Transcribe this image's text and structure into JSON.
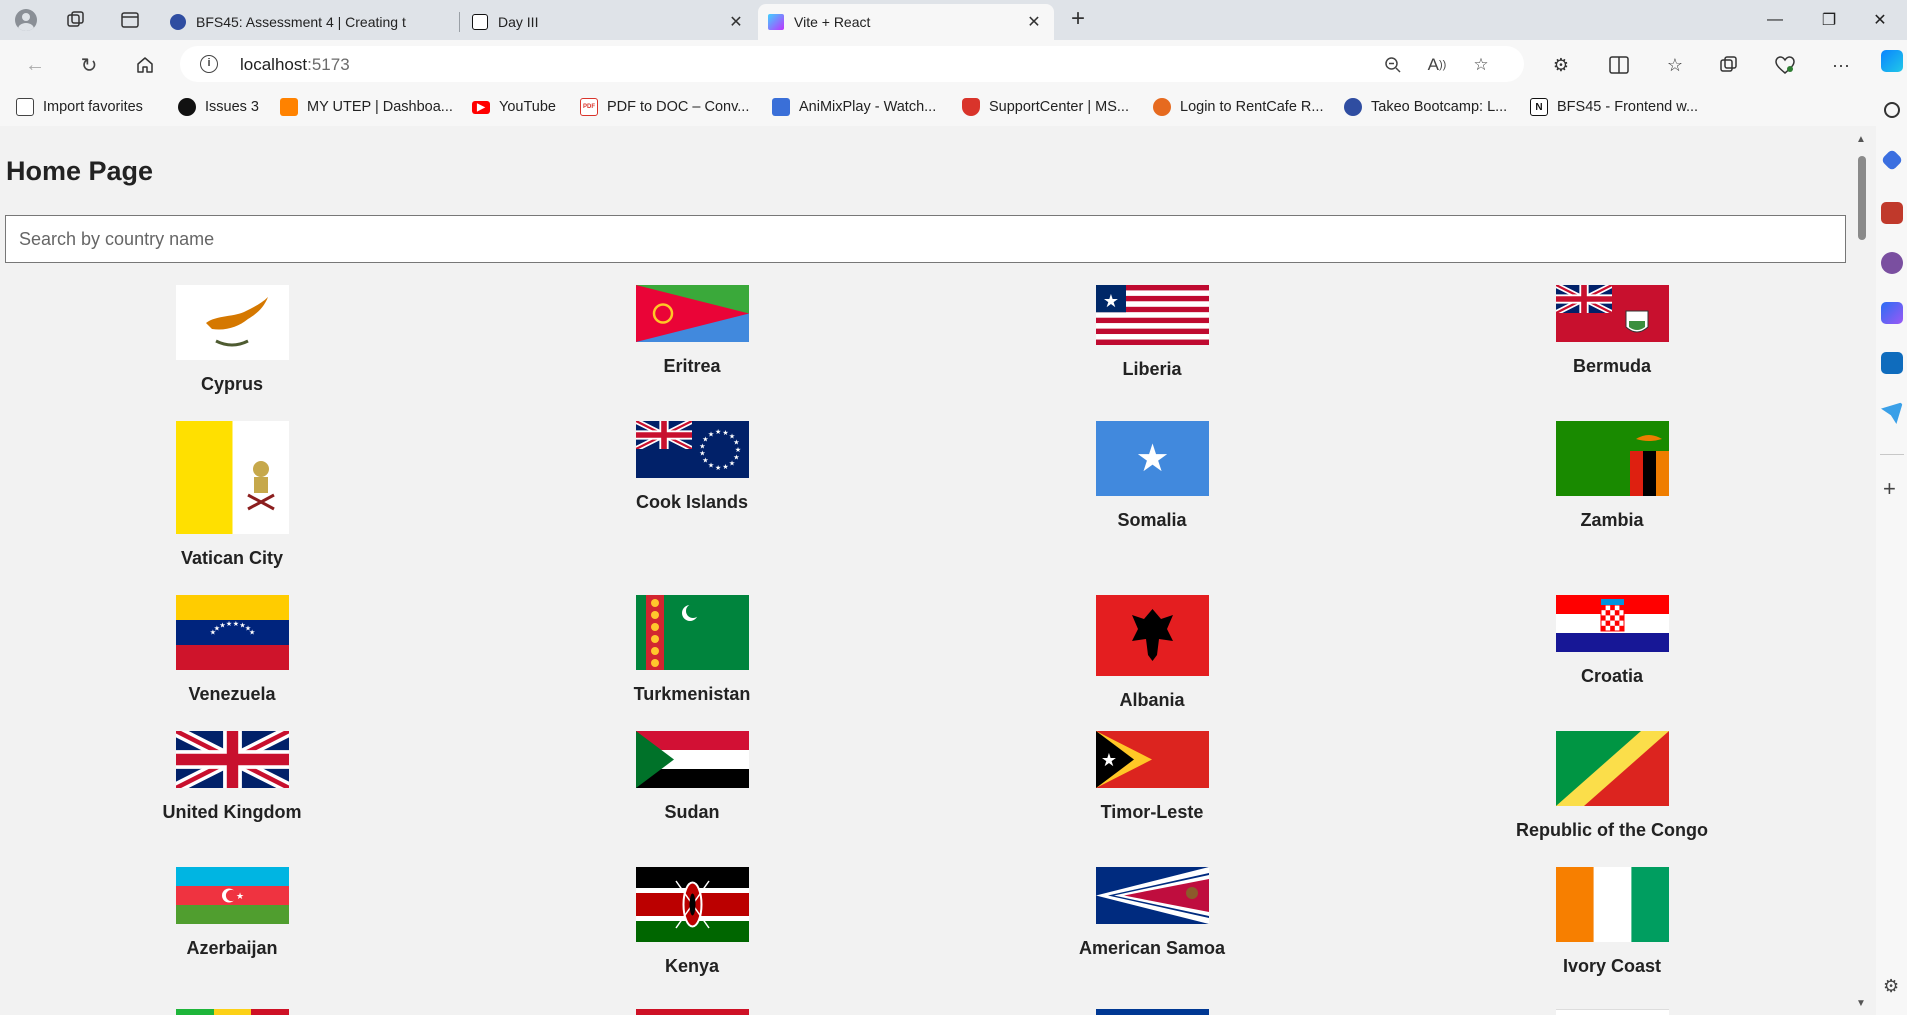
{
  "browser": {
    "tabs": [
      {
        "title": "BFS45: Assessment 4 | Creating t",
        "favicon_color": "#2f4da1"
      },
      {
        "title": "Day III",
        "favicon_color": "#111111"
      },
      {
        "title": "Vite + React",
        "favicon_color": "#a855f7"
      }
    ],
    "address": {
      "host": "localhost",
      "port": ":5173"
    },
    "favorites": [
      {
        "label": "Import favorites",
        "icon": "import-icon",
        "color": "#444444"
      },
      {
        "label": "Issues 3",
        "icon": "github-icon",
        "color": "#111111"
      },
      {
        "label": "MY UTEP | Dashboa...",
        "icon": "utep-icon",
        "color": "#ff8200"
      },
      {
        "label": "YouTube",
        "icon": "youtube-icon",
        "color": "#ff0000"
      },
      {
        "label": "PDF to DOC – Conv...",
        "icon": "pdf-icon",
        "color": "#d9342b"
      },
      {
        "label": "AniMixPlay - Watch...",
        "icon": "animix-icon",
        "color": "#3a6fd8"
      },
      {
        "label": "SupportCenter | MS...",
        "icon": "support-icon",
        "color": "#d9342b"
      },
      {
        "label": "Login to RentCafe R...",
        "icon": "rentcafe-icon",
        "color": "#e66a1f"
      },
      {
        "label": "Takeo Bootcamp: L...",
        "icon": "takeo-icon",
        "color": "#2f4da1"
      },
      {
        "label": "BFS45 - Frontend w...",
        "icon": "notion-icon",
        "color": "#111111"
      }
    ]
  },
  "page": {
    "title": "Home Page",
    "search_placeholder": "Search by country name",
    "countries": [
      {
        "name": "Cyprus",
        "flag": "cyprus"
      },
      {
        "name": "Eritrea",
        "flag": "eritrea"
      },
      {
        "name": "Liberia",
        "flag": "liberia"
      },
      {
        "name": "Bermuda",
        "flag": "bermuda"
      },
      {
        "name": "Vatican City",
        "flag": "vatican"
      },
      {
        "name": "Cook Islands",
        "flag": "cook"
      },
      {
        "name": "Somalia",
        "flag": "somalia"
      },
      {
        "name": "Zambia",
        "flag": "zambia"
      },
      {
        "name": "Venezuela",
        "flag": "venezuela"
      },
      {
        "name": "Turkmenistan",
        "flag": "turkmenistan"
      },
      {
        "name": "Albania",
        "flag": "albania"
      },
      {
        "name": "Croatia",
        "flag": "croatia"
      },
      {
        "name": "United Kingdom",
        "flag": "uk"
      },
      {
        "name": "Sudan",
        "flag": "sudan"
      },
      {
        "name": "Timor-Leste",
        "flag": "timor"
      },
      {
        "name": "Republic of the Congo",
        "flag": "congo"
      },
      {
        "name": "Azerbaijan",
        "flag": "azerbaijan"
      },
      {
        "name": "Kenya",
        "flag": "kenya"
      },
      {
        "name": "American Samoa",
        "flag": "samoa"
      },
      {
        "name": "Ivory Coast",
        "flag": "ivorycoast"
      }
    ]
  }
}
